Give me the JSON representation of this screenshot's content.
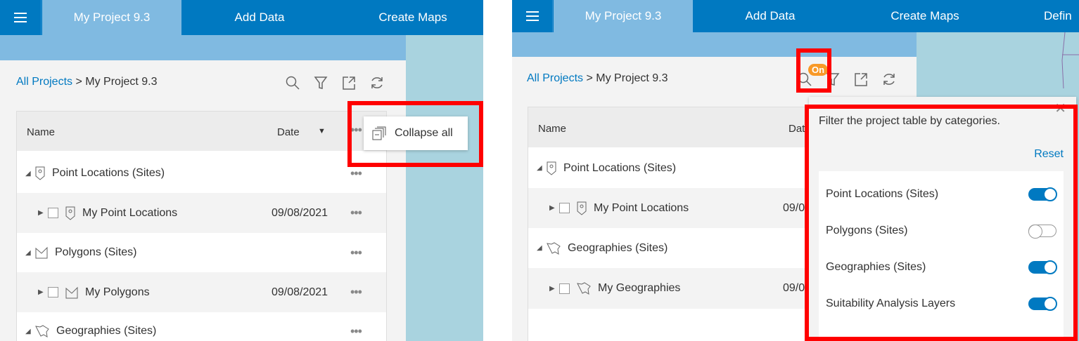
{
  "nav": {
    "tabs": [
      "My Project 9.3",
      "Add Data",
      "Create Maps",
      "Defin"
    ],
    "menu_icon": "hamburger-icon"
  },
  "breadcrumb": {
    "root": "All Projects",
    "separator": " > ",
    "current": "My Project 9.3"
  },
  "toolbar": {
    "icons": [
      "search-icon",
      "filter-icon",
      "export-icon",
      "refresh-icon"
    ],
    "filter_badge": "On"
  },
  "table": {
    "col_name": "Name",
    "col_date": "Date"
  },
  "left": {
    "rows": [
      {
        "label": "Point Locations (Sites)",
        "type": "group"
      },
      {
        "label": "My Point Locations",
        "date": "09/08/2021",
        "type": "child"
      },
      {
        "label": "Polygons (Sites)",
        "type": "group"
      },
      {
        "label": "My Polygons",
        "date": "09/08/2021",
        "type": "child"
      },
      {
        "label": "Geographies (Sites)",
        "type": "group"
      }
    ],
    "menu": {
      "collapse_all": "Collapse all"
    }
  },
  "right": {
    "rows": [
      {
        "label": "Point Locations (Sites)",
        "type": "group"
      },
      {
        "label": "My Point Locations",
        "date": "09/0",
        "type": "child"
      },
      {
        "label": "Geographies (Sites)",
        "type": "group"
      },
      {
        "label": "My Geographies",
        "date": "09/0",
        "type": "child"
      }
    ],
    "filter": {
      "title": "Filter the project table by categories.",
      "reset": "Reset",
      "items": [
        {
          "label": "Point Locations (Sites)",
          "on": true
        },
        {
          "label": "Polygons (Sites)",
          "on": false
        },
        {
          "label": "Geographies (Sites)",
          "on": true
        },
        {
          "label": "Suitability Analysis Layers",
          "on": true
        }
      ]
    }
  },
  "colors": {
    "brand": "#0079c1",
    "active_tab": "#80bae1",
    "highlight": "#ff0000",
    "badge": "#f89927"
  }
}
